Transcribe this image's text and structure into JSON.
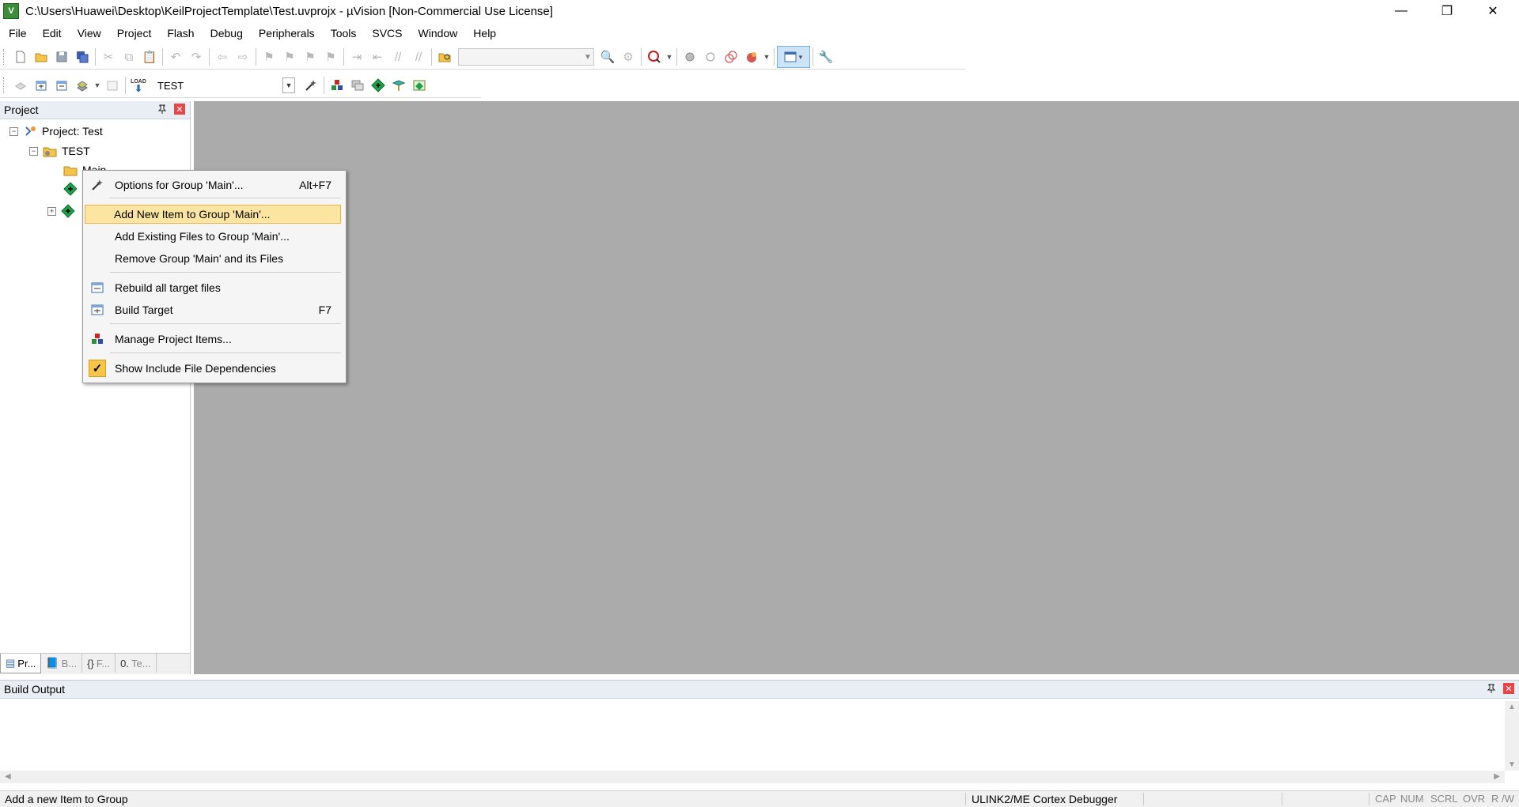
{
  "window": {
    "title": "C:\\Users\\Huawei\\Desktop\\KeilProjectTemplate\\Test.uvprojx - µVision  [Non-Commercial Use License]",
    "app_icon_text": "V",
    "minimize": "—",
    "restore": "❐",
    "close": "✕"
  },
  "menu": [
    "File",
    "Edit",
    "View",
    "Project",
    "Flash",
    "Debug",
    "Peripherals",
    "Tools",
    "SVCS",
    "Window",
    "Help"
  ],
  "toolbar2": {
    "target_value": "TEST",
    "load_label": "LOAD"
  },
  "project_panel": {
    "title": "Project",
    "pin": "📌",
    "close": "✕",
    "tree": {
      "root": "Project: Test",
      "target": "TEST",
      "group": "Main"
    },
    "tabs": [
      "Pr...",
      "B...",
      "F...",
      "Te..."
    ]
  },
  "context_menu": {
    "items": [
      {
        "label": "Options for Group 'Main'...",
        "shortcut": "Alt+F7"
      },
      {
        "label": "Add New  Item to Group 'Main'..."
      },
      {
        "label": "Add Existing Files to Group 'Main'..."
      },
      {
        "label": "Remove Group 'Main' and its Files"
      },
      {
        "label": "Rebuild all target files"
      },
      {
        "label": "Build Target",
        "shortcut": "F7"
      },
      {
        "label": "Manage Project Items..."
      },
      {
        "label": "Show Include File Dependencies",
        "checked": true
      }
    ]
  },
  "build_output": {
    "title": "Build Output",
    "pin": "📌",
    "close": "✕"
  },
  "statusbar": {
    "message": "Add a new Item to Group",
    "debugger": "ULINK2/ME Cortex Debugger",
    "cap": "CAP",
    "num": "NUM",
    "scrl": "SCRL",
    "ovr": "OVR",
    "rw": "R /W"
  },
  "colors": {
    "workspace_bg": "#ababab",
    "menu_highlight": "#fce4a1",
    "panel_header": "#e9eef5"
  }
}
